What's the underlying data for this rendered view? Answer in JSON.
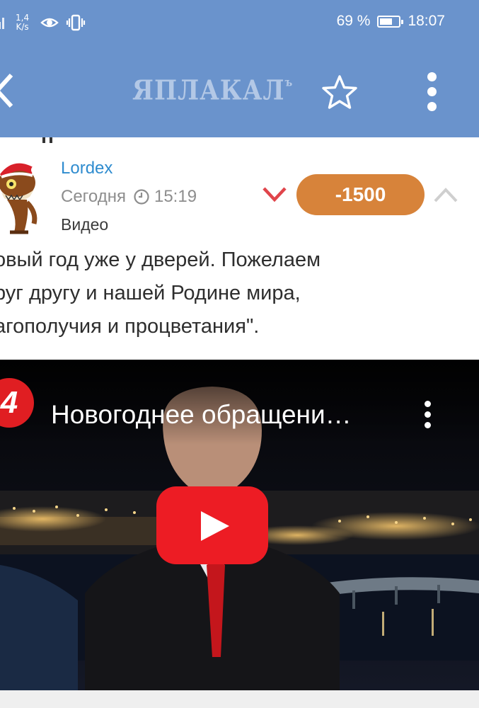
{
  "status_bar": {
    "net_speed_value": "1,4",
    "net_speed_unit": "K/s",
    "battery_text": "69 %",
    "battery_level": 0.69,
    "time": "18:07",
    "icons": [
      "signal-icon",
      "eye-icon",
      "vibrate-icon",
      "battery-icon"
    ]
  },
  "app_bar": {
    "logo_text": "ЯПЛАКАЛ",
    "logo_suffix": "ъ",
    "icons": [
      "back-icon",
      "star-icon",
      "more-vertical-icon"
    ],
    "color": "#6a93cc"
  },
  "post": {
    "author": "Lordex",
    "date_label": "Сегодня",
    "time": "15:19",
    "section": "Видео",
    "rating": "-1500",
    "rating_color": "#d7833a",
    "downvote_color": "#e0454b",
    "text": "овый год уже у дверей. Пожелаем\nруг другу и нашей Родине мира,\nагополучия и процветания\"."
  },
  "video": {
    "channel_logo": "4",
    "title": "Новогоднее обращени…",
    "icons": [
      "play-icon",
      "more-vertical-icon"
    ],
    "play_color": "#ed1c24"
  }
}
